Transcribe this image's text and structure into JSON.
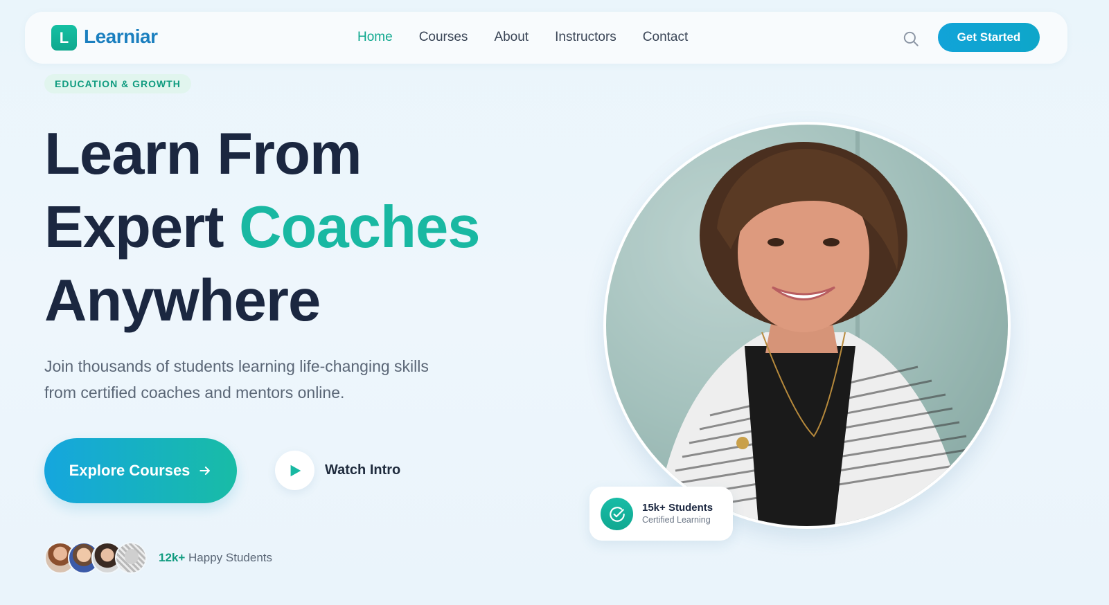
{
  "brand": {
    "logo_letter": "L",
    "name": "Learniar"
  },
  "nav": {
    "links": [
      {
        "label": "Home",
        "active": true
      },
      {
        "label": "Courses"
      },
      {
        "label": "About"
      },
      {
        "label": "Instructors"
      },
      {
        "label": "Contact"
      }
    ],
    "search_icon": "search-icon",
    "cta_label": "Get Started"
  },
  "hero": {
    "tag": "EDUCATION & GROWTH",
    "headline_line1": "Learn From",
    "headline_line2_plain": "Expert",
    "headline_line2_accent": "Coaches",
    "headline_line3": "Anywhere",
    "subtitle": "Join thousands of students learning life-changing skills from certified coaches and mentors online.",
    "primary_cta": "Explore Courses",
    "secondary_cta": "Watch Intro",
    "social_proof_count": "12k+",
    "social_proof_label": "Happy Students"
  },
  "badge": {
    "title": "15k+ Students",
    "subtitle": "Certified Learning"
  },
  "colors": {
    "accent": "#19b8a2",
    "brand_blue": "#1b7fbf",
    "heading": "#1b2740"
  }
}
